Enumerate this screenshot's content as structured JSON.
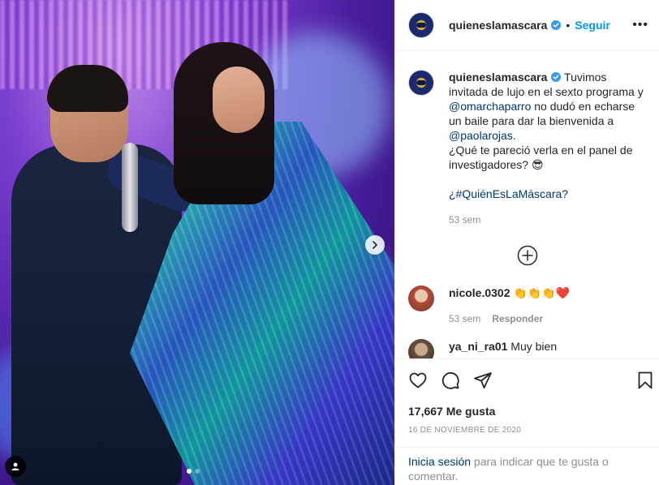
{
  "post": {
    "username": "quieneslamascara",
    "follow_label": "Seguir",
    "separator": "•",
    "more_label": "•••"
  },
  "caption": {
    "username": "quieneslamascara",
    "text_1": " Tuvimos invitada de lujo en el sexto programa y ",
    "mention_1": "@omarchaparro",
    "text_2": " no dudó en echarse un baile para dar la bienvenida a ",
    "mention_2": "@paolarojas",
    "text_3": ".",
    "text_4": "¿Qué te pareció verla en el panel de investigadores? 😎",
    "hashtag": "¿#QuiénEsLaMáscara",
    "hashtag_suffix": "?",
    "time": "53 sem"
  },
  "comments": [
    {
      "username": "nicole.0302",
      "text": "👏👏👏❤️",
      "time": "53 sem",
      "reply_label": "Responder"
    },
    {
      "username": "ya_ni_ra01",
      "text": "Muy bien"
    }
  ],
  "stats": {
    "likes": "17,667 Me gusta",
    "date": "16 DE NOVIEMBRE DE 2020"
  },
  "login": {
    "link": "Inicia sesión",
    "rest": " para indicar que te gusta o comentar."
  },
  "media": {
    "slide_count": 2,
    "active_slide": 1
  },
  "colors": {
    "accent": "#0095f6",
    "mention": "#00376b",
    "muted": "#8e8e8e",
    "verified": "#3897f0"
  },
  "icons": [
    "verified-badge-icon",
    "more-options-icon",
    "next-arrow-icon",
    "user-tag-icon",
    "add-comment-circle-icon",
    "heart-icon",
    "comment-icon",
    "share-icon",
    "bookmark-icon"
  ]
}
